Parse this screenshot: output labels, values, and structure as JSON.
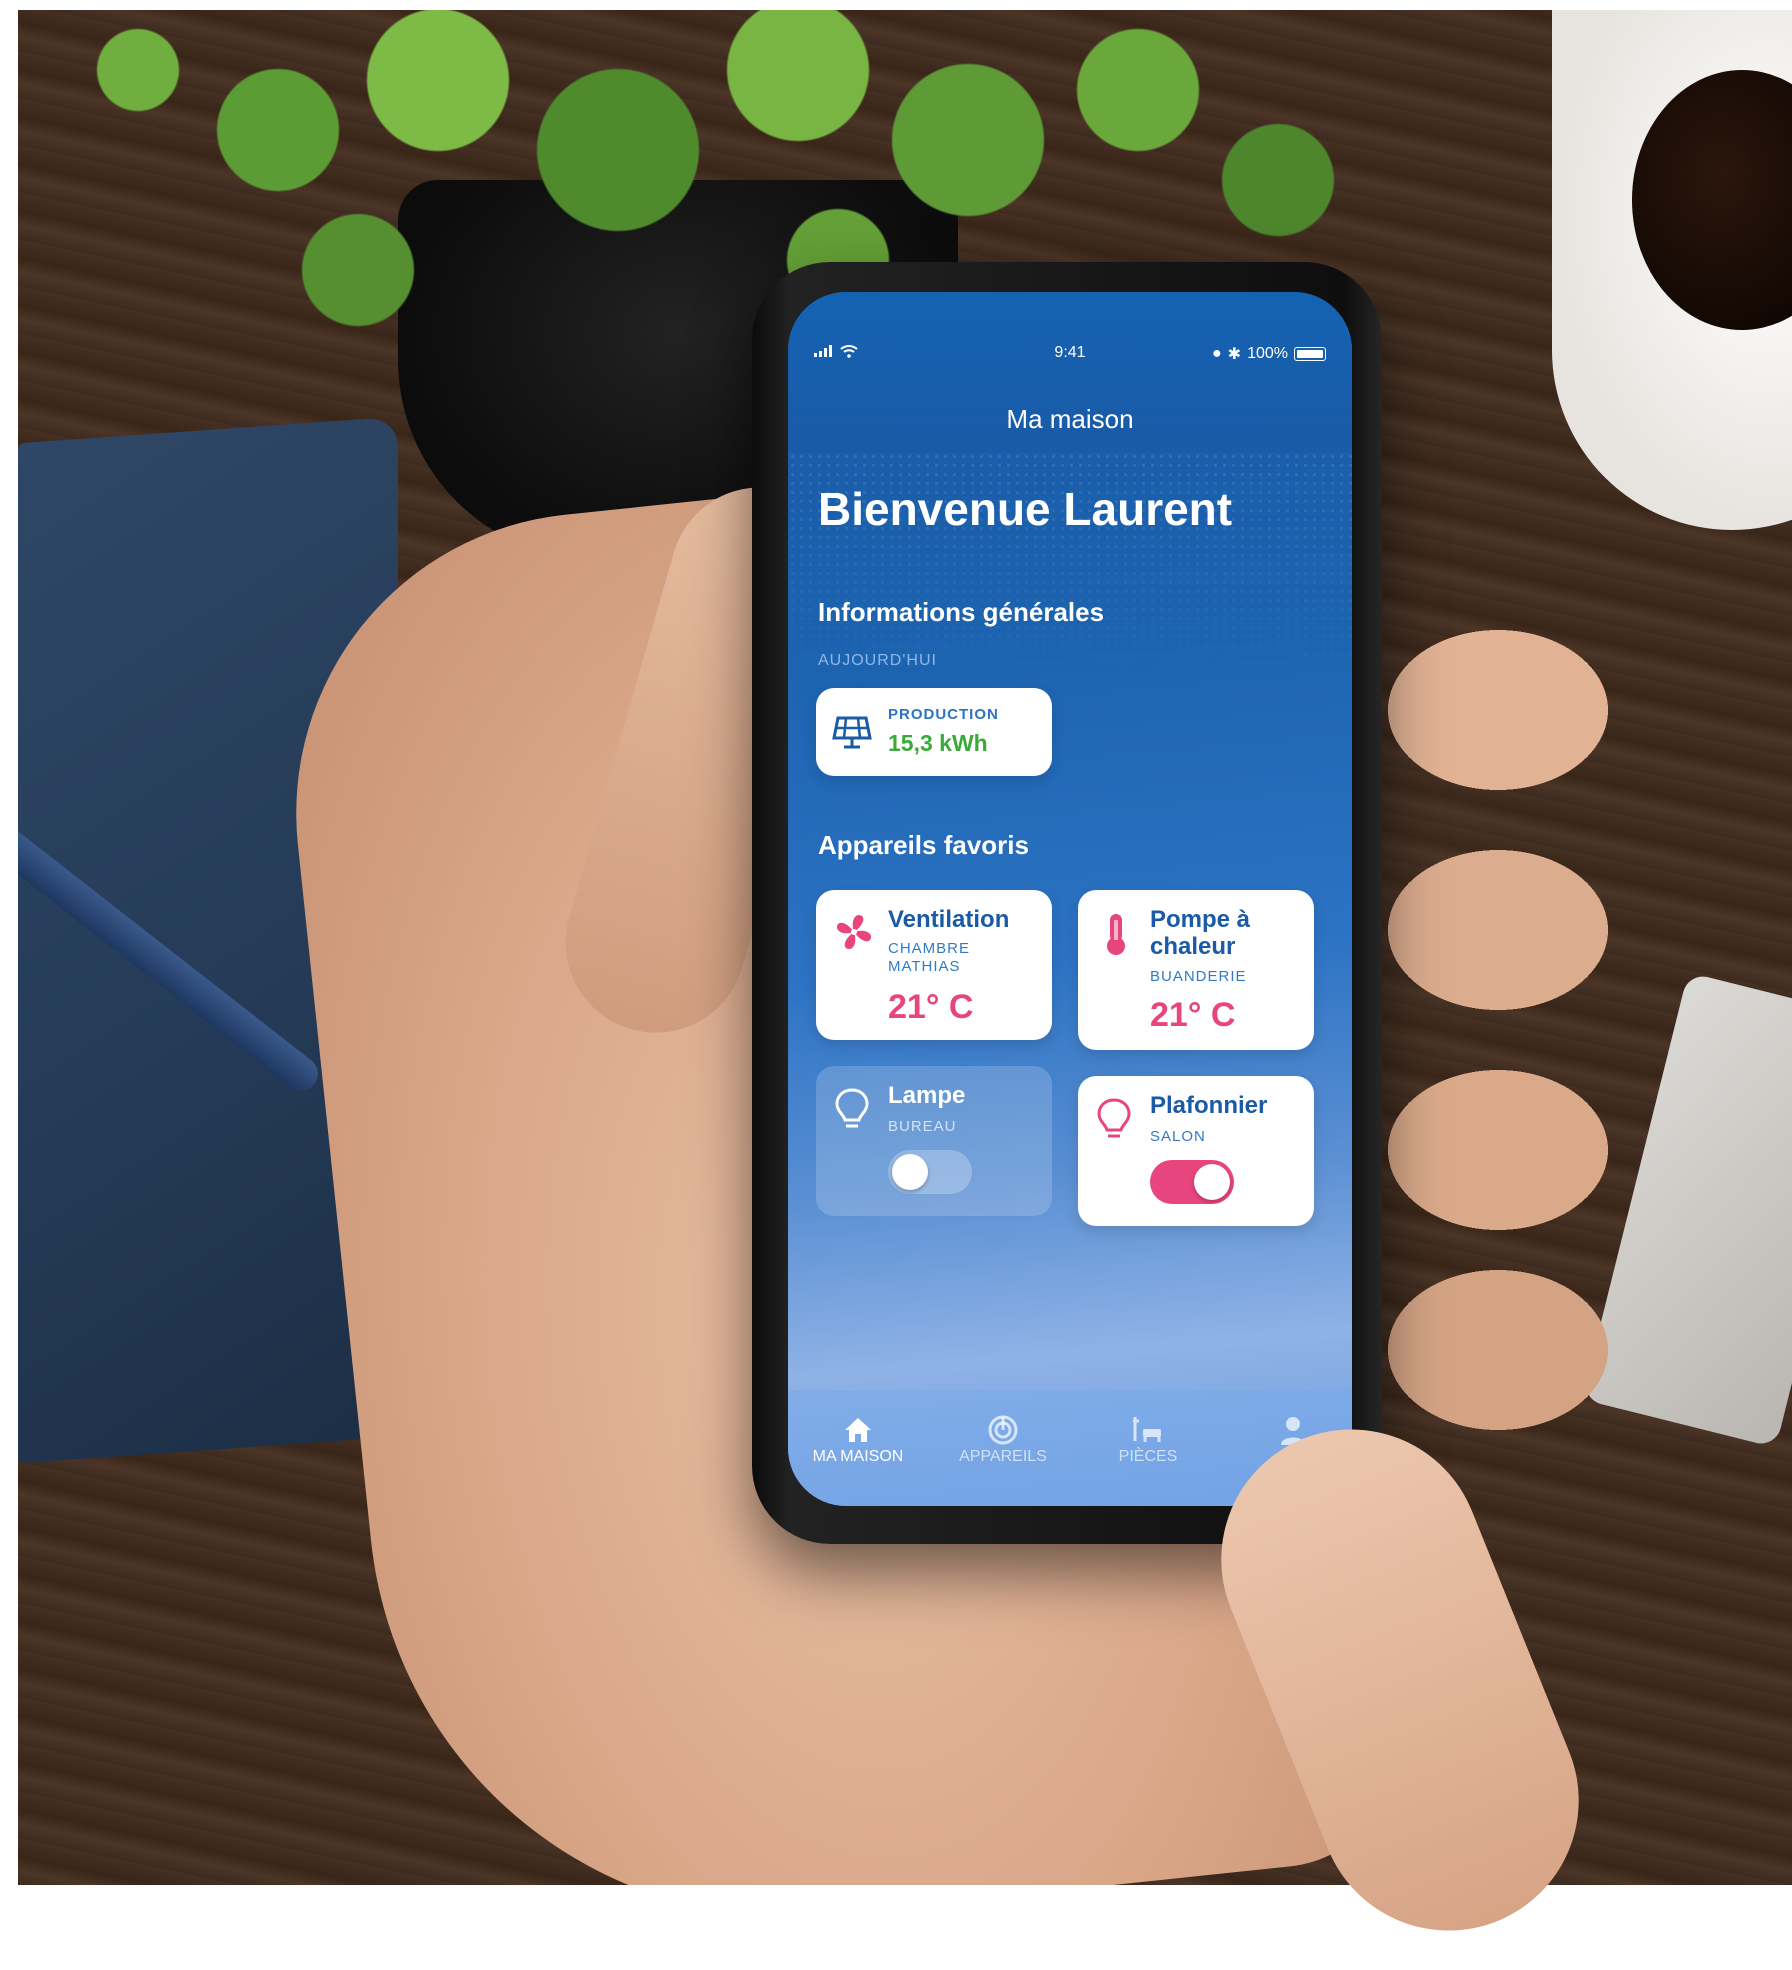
{
  "status_bar": {
    "time": "9:41",
    "battery": "100%"
  },
  "nav": {
    "title": "Ma maison"
  },
  "welcome": "Bienvenue Laurent",
  "general": {
    "title": "Informations générales",
    "caption": "AUJOURD'HUI",
    "production": {
      "label": "PRODUCTION",
      "value": "15,3 kWh"
    }
  },
  "favorites": {
    "title": "Appareils favoris",
    "cards": [
      {
        "title_lines": [
          "Ventilation"
        ],
        "sub_lines": [
          "CHAMBRE",
          "MATHIAS"
        ],
        "temp": "21° C",
        "icon": "fan-icon"
      },
      {
        "title_lines": [
          "Pompe à",
          "chaleur"
        ],
        "sub_lines": [
          "BUANDERIE"
        ],
        "temp": "21° C",
        "icon": "thermometer-icon"
      },
      {
        "title_lines": [
          "Lampe"
        ],
        "sub_lines": [
          "BUREAU"
        ],
        "toggle_on": false,
        "icon": "bulb-icon"
      },
      {
        "title_lines": [
          "Plafonnier"
        ],
        "sub_lines": [
          "SALON"
        ],
        "toggle_on": true,
        "icon": "bulb-icon"
      }
    ]
  },
  "tabbar": {
    "tabs": [
      {
        "label": "MA MAISON",
        "icon": "home-icon",
        "active": true
      },
      {
        "label": "APPAREILS",
        "icon": "devices-icon",
        "active": false
      },
      {
        "label": "PIÈCES",
        "icon": "rooms-icon",
        "active": false
      },
      {
        "label": "",
        "icon": "profile-icon",
        "active": false
      }
    ]
  },
  "colors": {
    "accent_pink": "#e8457e",
    "brand_blue": "#1a5aa6",
    "production_green": "#3aab3a"
  }
}
